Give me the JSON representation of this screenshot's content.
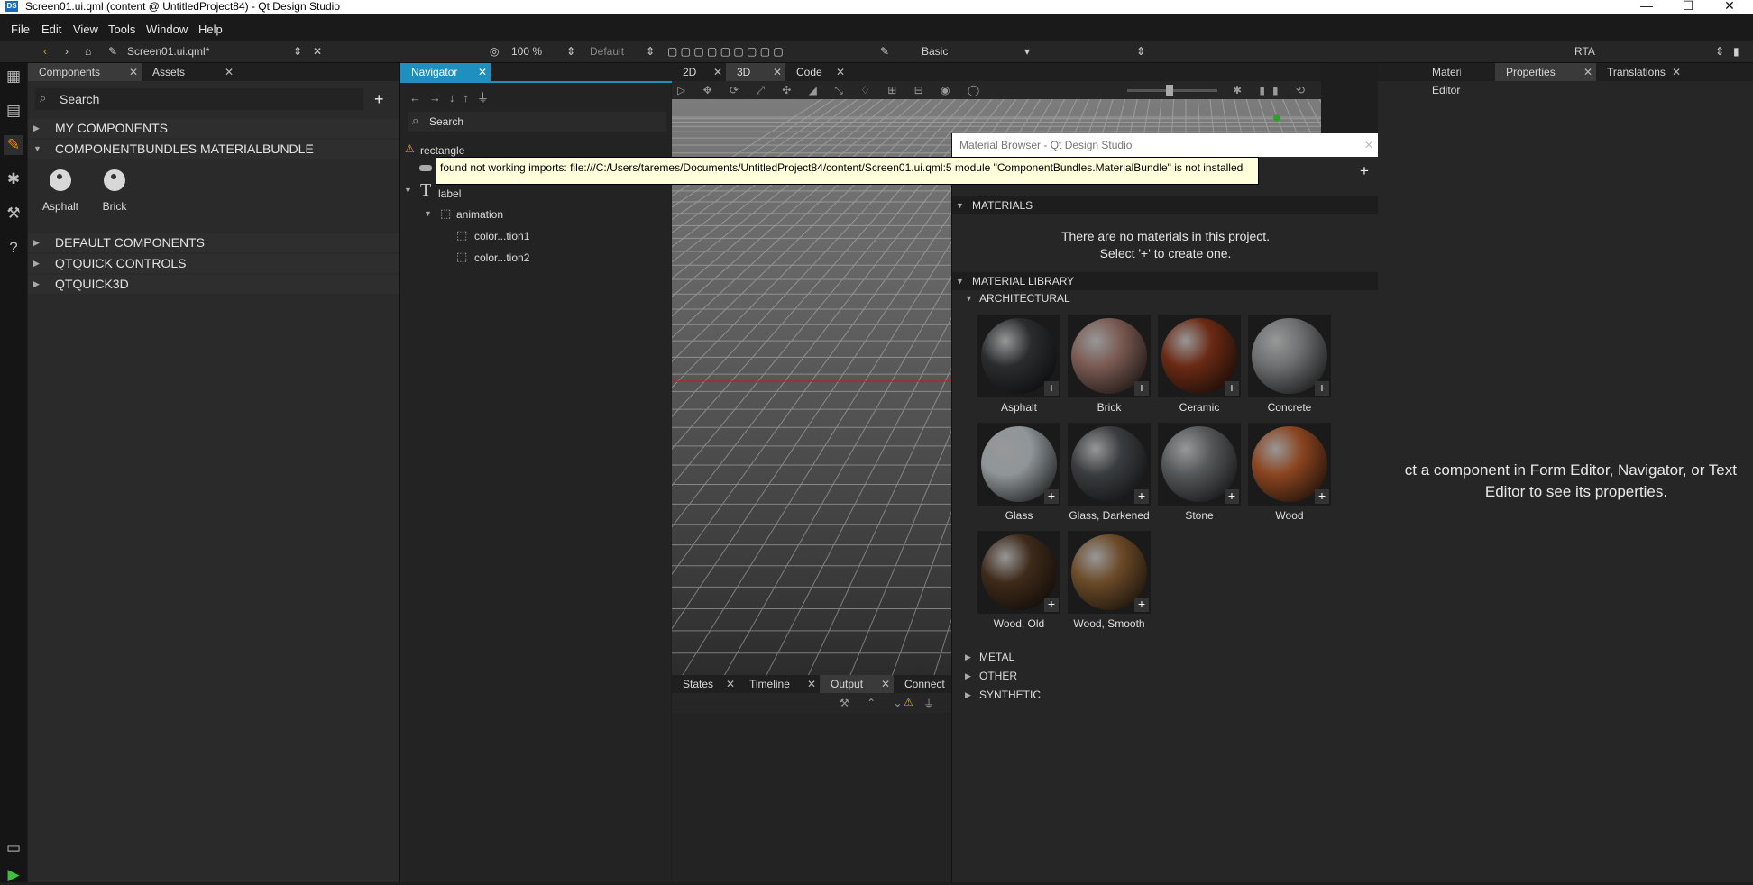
{
  "window": {
    "app_icon": "DS",
    "title": "Screen01.ui.qml (content @ UntitledProject84) - Qt Design Studio",
    "minimize": "—",
    "maximize": "☐",
    "close": "✕"
  },
  "menu": [
    "File",
    "Edit",
    "View",
    "Tools",
    "Window",
    "Help"
  ],
  "toolbar": {
    "file_name": "Screen01.ui.qml*",
    "zoom": "100 %",
    "state": "Default",
    "style": "Basic",
    "preset": "RTA"
  },
  "components_panel": {
    "tabs": [
      "Components",
      "Assets"
    ],
    "search_placeholder": "Search",
    "sections": [
      "MY COMPONENTS",
      "COMPONENTBUNDLES MATERIALBUNDLE",
      "DEFAULT COMPONENTS",
      "QTQUICK CONTROLS",
      "QTQUICK3D"
    ],
    "bundle_items": [
      "Asphalt",
      "Brick"
    ]
  },
  "navigator": {
    "tab": "Navigator",
    "search_placeholder": "Search",
    "tree": [
      {
        "label": "rectangle",
        "depth": 0,
        "warning": true
      },
      {
        "label": "",
        "depth": 0
      },
      {
        "label": "label",
        "depth": 0
      },
      {
        "label": "animation",
        "depth": 1
      },
      {
        "label": "color...tion1",
        "depth": 2
      },
      {
        "label": "color...tion2",
        "depth": 2
      }
    ]
  },
  "view_tabs": [
    "2D",
    "3D",
    "Code"
  ],
  "bottom_tabs": [
    "States",
    "Timeline",
    "Output",
    "Connect"
  ],
  "tooltip": "found not working imports: file:///C:/Users/taremes/Documents/UntitledProject84/content/Screen01.ui.qml:5 module \"ComponentBundles.MaterialBundle\" is not installed",
  "material_browser": {
    "title": "Material Browser - Qt Design Studio",
    "materials_header": "MATERIALS",
    "empty_line1": "There are no materials in this project.",
    "empty_line2": "Select '+' to create one.",
    "library_header": "MATERIAL LIBRARY",
    "categories": [
      "ARCHITECTURAL",
      "METAL",
      "OTHER",
      "SYNTHETIC"
    ],
    "materials": [
      "Asphalt",
      "Brick",
      "Ceramic",
      "Concrete",
      "Glass",
      "Glass, Darkened",
      "Stone",
      "Wood",
      "Wood, Old",
      "Wood, Smooth"
    ],
    "material_colors": [
      "#2a2c2e",
      "#7a5a52",
      "#6a2a14",
      "#6d6f70",
      "#8f9598",
      "#3a3d40",
      "#55585a",
      "#8b4520",
      "#3e2a1a",
      "#6b4a28"
    ]
  },
  "right_panel": {
    "tabs": [
      "Material Editor",
      "Properties",
      "Translations"
    ],
    "hint_line1": "ct a component in Form Editor, Navigator, or Text",
    "hint_line2": "Editor to see its properties."
  }
}
